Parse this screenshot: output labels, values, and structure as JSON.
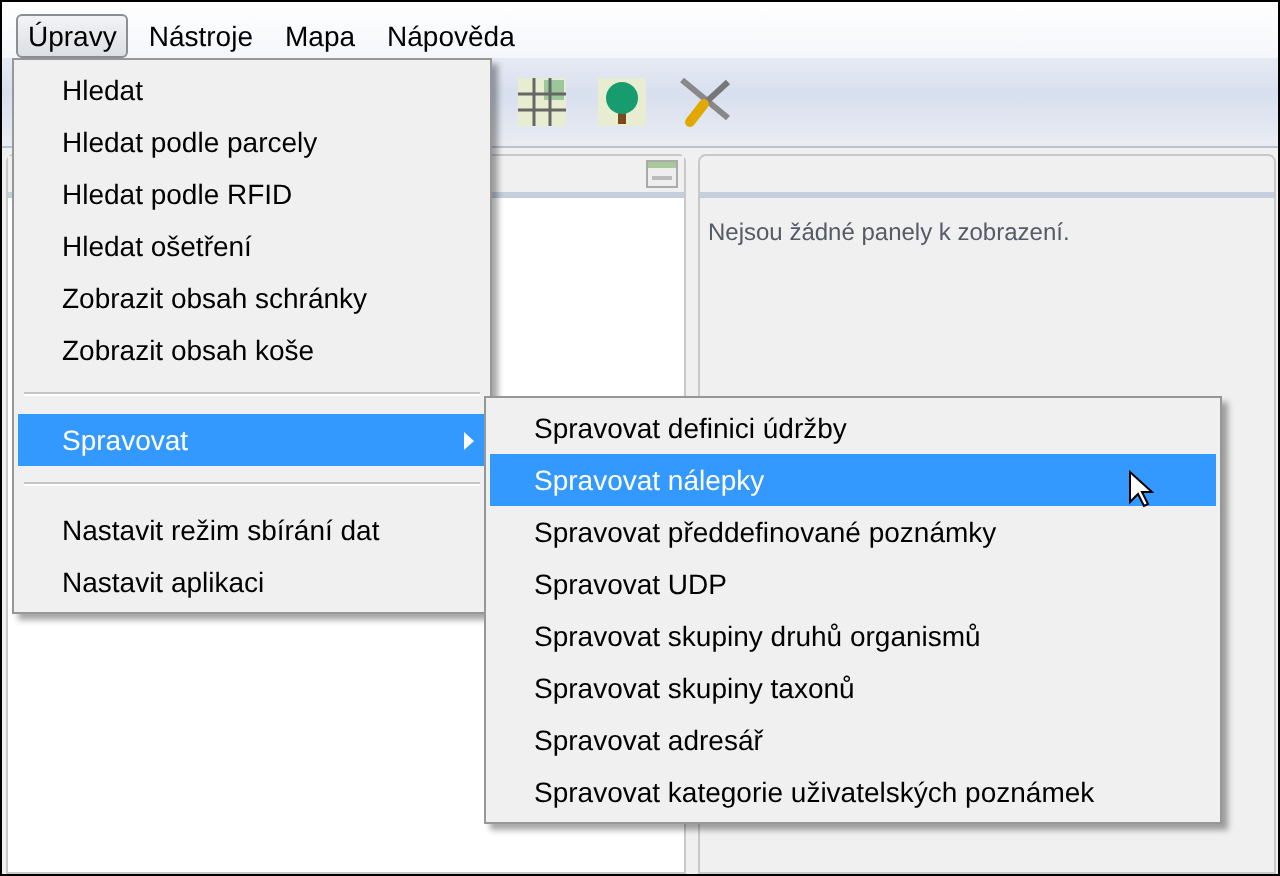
{
  "menubar": [
    {
      "label": "Úpravy",
      "selected": true
    },
    {
      "label": "Nástroje",
      "selected": false
    },
    {
      "label": "Mapa",
      "selected": false
    },
    {
      "label": "Nápověda",
      "selected": false
    }
  ],
  "right_panel": {
    "message": "Nejsou žádné panely k zobrazení."
  },
  "menu": [
    {
      "kind": "item",
      "label": "Hledat",
      "selected": false
    },
    {
      "kind": "item",
      "label": "Hledat podle parcely",
      "selected": false
    },
    {
      "kind": "item",
      "label": "Hledat podle RFID",
      "selected": false
    },
    {
      "kind": "item",
      "label": "Hledat ošetření",
      "selected": false
    },
    {
      "kind": "item",
      "label": "Zobrazit obsah schránky",
      "selected": false
    },
    {
      "kind": "item",
      "label": "Zobrazit obsah koše",
      "selected": false
    },
    {
      "kind": "separator"
    },
    {
      "kind": "submenu",
      "label": "Spravovat",
      "selected": true
    },
    {
      "kind": "separator"
    },
    {
      "kind": "item",
      "label": "Nastavit režim sbírání dat",
      "selected": false
    },
    {
      "kind": "item",
      "label": "Nastavit aplikaci",
      "selected": false
    }
  ],
  "submenu": [
    {
      "label": "Spravovat definici údržby",
      "selected": false
    },
    {
      "label": "Spravovat nálepky",
      "selected": true
    },
    {
      "label": "Spravovat předdefinované poznámky",
      "selected": false
    },
    {
      "label": "Spravovat UDP",
      "selected": false
    },
    {
      "label": "Spravovat skupiny druhů organismů",
      "selected": false
    },
    {
      "label": "Spravovat skupiny taxonů",
      "selected": false
    },
    {
      "label": "Spravovat adresář",
      "selected": false
    },
    {
      "label": "Spravovat kategorie uživatelských poznámek",
      "selected": false
    }
  ]
}
